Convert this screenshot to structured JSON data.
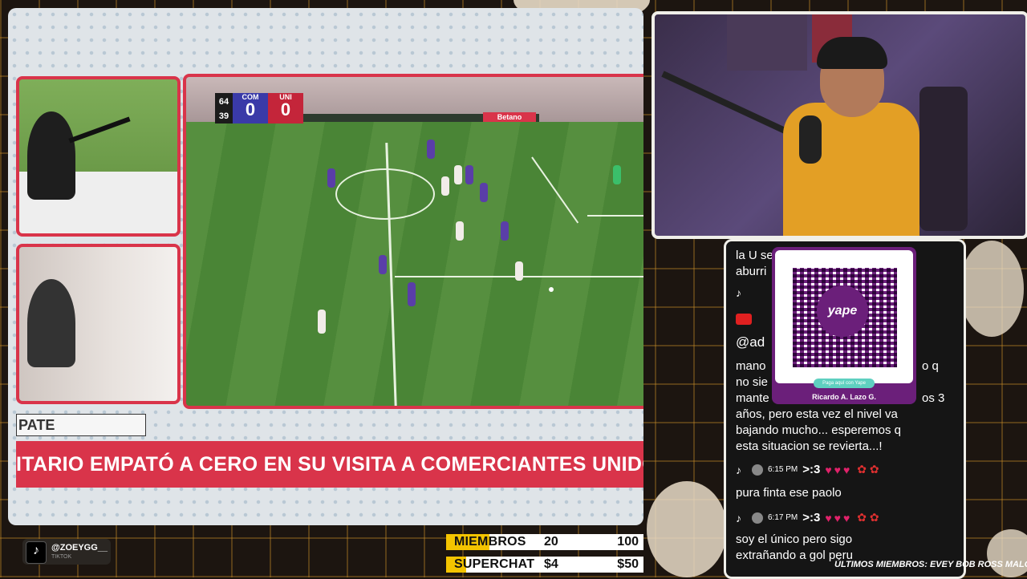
{
  "scoreboard": {
    "clock_top": "64",
    "clock_bottom": "39",
    "home": "COM",
    "away": "UNI",
    "home_score": "0",
    "away_score": "0"
  },
  "ad_text": "Betano",
  "lower_third": {
    "label": "PATE",
    "headline": "ITARIO EMPATÓ A CERO EN SU VISITA A COMERCIANTES UNIDOS"
  },
  "chat": {
    "lines": [
      {
        "text": "la U se"
      },
      {
        "text": "aburri"
      },
      {
        "text": "@ad"
      },
      {
        "text": "mano"
      },
      {
        "text": "no sie"
      },
      {
        "text": "mante"
      },
      {
        "text": "años, pero esta vez el nivel va"
      },
      {
        "text": "bajando mucho... esperemos q"
      },
      {
        "text": "esta situacion se revierta...!"
      },
      {
        "text": "pura finta ese paolo"
      },
      {
        "text": "soy el único pero sigo"
      },
      {
        "text": "extrañando a gol peru"
      }
    ],
    "right_fragments": {
      "o_q": "o q",
      "os_3": "os 3"
    },
    "meta": [
      {
        "time": "6:15 PM",
        "user": ">:3"
      },
      {
        "time": "6:17 PM",
        "user": ">:3"
      }
    ]
  },
  "qr": {
    "badge": "yape",
    "button": "Paga aquí con Yape",
    "name": "Ricardo A. Lazo G."
  },
  "goals": [
    {
      "label": "MIEMBROS",
      "value": "20",
      "target": "100",
      "progress": 0.2
    },
    {
      "label": "SUPERCHAT",
      "value": "$4",
      "target": "$50",
      "progress": 0.08
    }
  ],
  "tiktok": {
    "handle": "@ZOEYGG__",
    "sub": "TIKTOK"
  },
  "members_strip": "ÚLTIMOS MIEMBROS: EVEY   BOB ROSS   MALORIE"
}
